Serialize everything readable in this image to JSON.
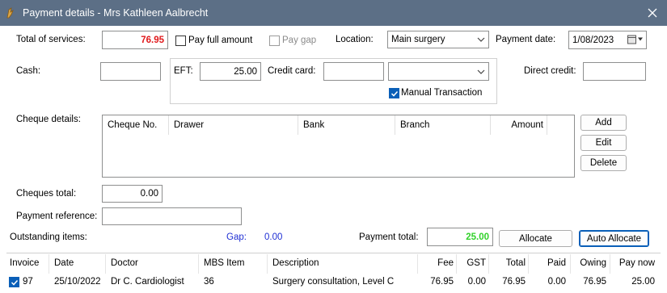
{
  "window": {
    "title": "Payment details - Mrs Kathleen Aalbrecht"
  },
  "total_of_services": {
    "label": "Total of services:",
    "value": "76.95"
  },
  "pay_full_amount": {
    "label": "Pay full amount",
    "checked": false
  },
  "pay_gap": {
    "label": "Pay gap",
    "checked": false,
    "enabled": false
  },
  "location": {
    "label": "Location:",
    "value": "Main surgery"
  },
  "payment_date": {
    "label": "Payment date:",
    "value": "1/08/2023"
  },
  "cash": {
    "label": "Cash:",
    "value": ""
  },
  "eft": {
    "label": "EFT:",
    "value": "25.00"
  },
  "credit_card": {
    "label": "Credit card:",
    "value": "",
    "card_type": ""
  },
  "manual_transaction": {
    "label": "Manual Transaction",
    "checked": true
  },
  "direct_credit": {
    "label": "Direct credit:",
    "value": ""
  },
  "cheque_details": {
    "label": "Cheque details:",
    "columns": [
      "Cheque No.",
      "Drawer",
      "Bank",
      "Branch",
      "Amount"
    ],
    "buttons": {
      "add": "Add",
      "edit": "Edit",
      "delete": "Delete"
    }
  },
  "cheques_total": {
    "label": "Cheques total:",
    "value": "0.00"
  },
  "payment_reference": {
    "label": "Payment reference:",
    "value": ""
  },
  "outstanding_items": {
    "label": "Outstanding items:"
  },
  "gap": {
    "label": "Gap:",
    "value": "0.00"
  },
  "payment_total": {
    "label": "Payment total:",
    "value": "25.00"
  },
  "actions": {
    "allocate": "Allocate",
    "auto_allocate": "Auto Allocate"
  },
  "items_table": {
    "columns": [
      "Invoice",
      "Date",
      "Doctor",
      "MBS Item",
      "Description",
      "Fee",
      "GST",
      "Total",
      "Paid",
      "Owing",
      "Pay now"
    ],
    "rows": [
      {
        "selected": true,
        "invoice": "97",
        "date": "25/10/2022",
        "doctor": "Dr C. Cardiologist",
        "mbs_item": "36",
        "description": "Surgery consultation, Level C",
        "fee": "76.95",
        "gst": "0.00",
        "total": "76.95",
        "paid": "0.00",
        "owing": "76.95",
        "pay_now": "25.00"
      }
    ]
  },
  "colors": {
    "titlebar": "#5c6f86",
    "total_services": "#e0191b",
    "payment_total": "#31d22a",
    "gap": "#1f2fd4",
    "accent": "#0a5fb8"
  },
  "icons": [
    "app-icon",
    "close-icon",
    "calendar-icon",
    "chevron-down-icon",
    "checkmark-icon"
  ]
}
